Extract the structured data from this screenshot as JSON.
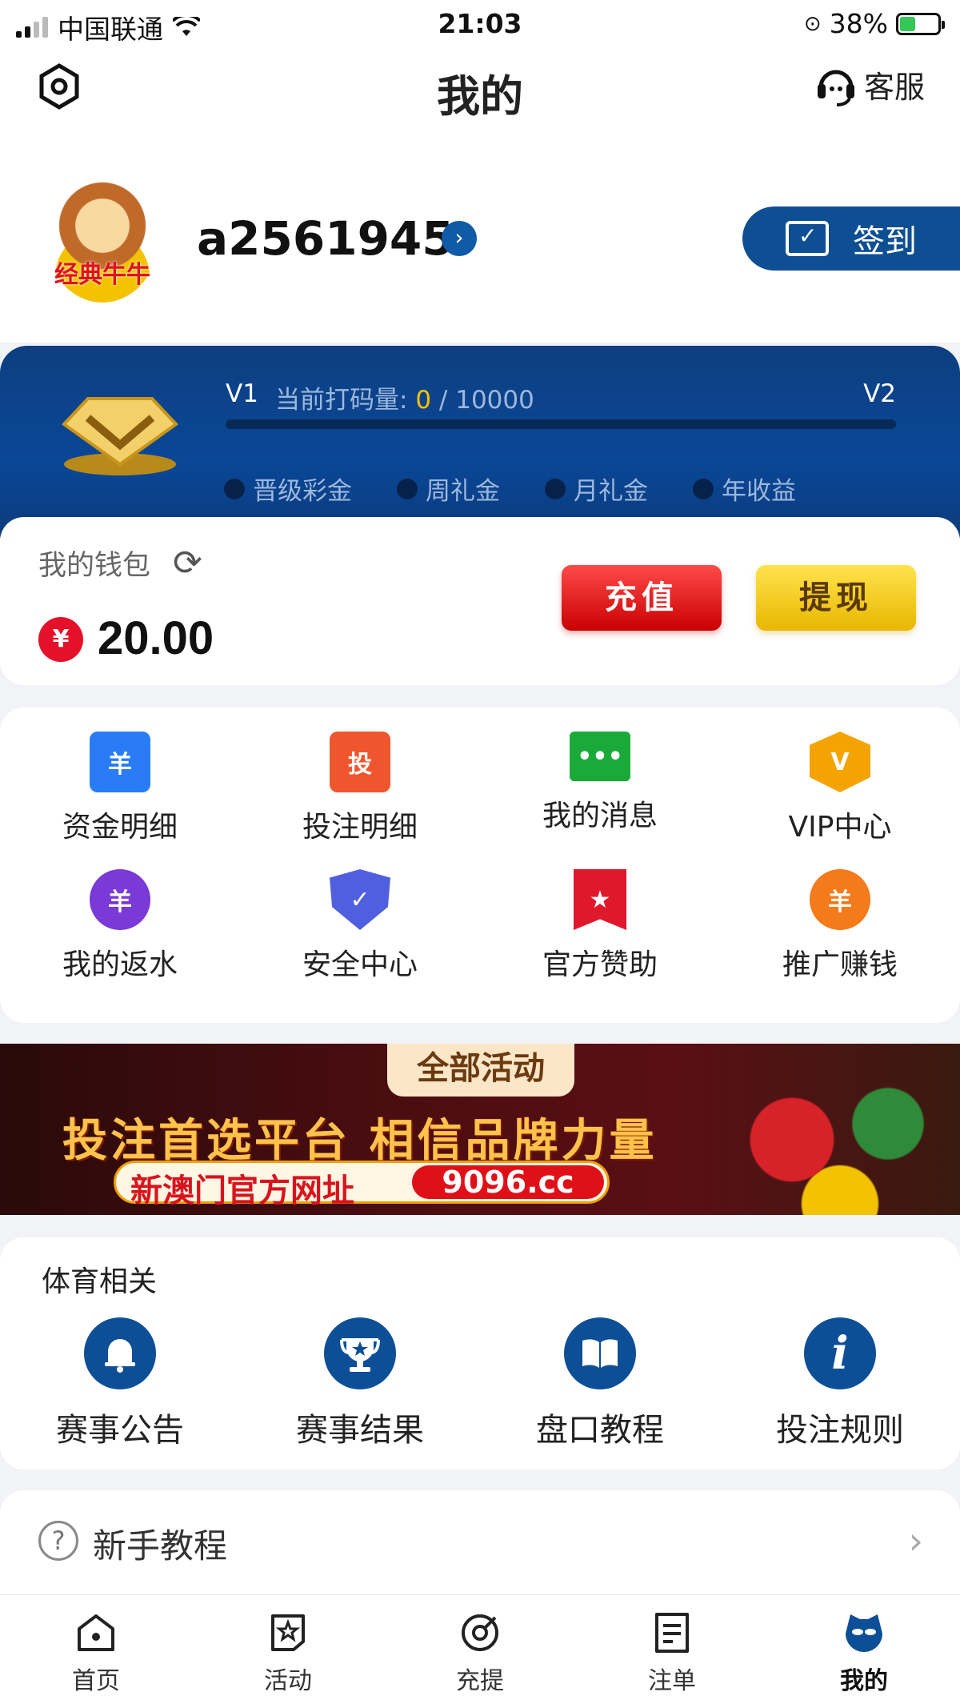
{
  "status_bar": {
    "carrier": "中国联通",
    "time": "21:03",
    "battery_percent": "38%"
  },
  "nav": {
    "title": "我的",
    "settings_icon": "gear-icon",
    "service_label": "客服",
    "service_icon": "headset-icon"
  },
  "profile": {
    "avatar_text": "经典牛牛",
    "username": "a2561945",
    "checkin_label": "签到"
  },
  "vip": {
    "current_level": "V1",
    "progress_label": "当前打码量:",
    "progress_current": "0",
    "progress_sep": "/",
    "progress_target": "10000",
    "progress_fraction": 0,
    "next_level": "V2",
    "perks": [
      "晋级彩金",
      "周礼金",
      "月礼金",
      "年收益"
    ]
  },
  "wallet": {
    "label": "我的钱包",
    "currency_symbol": "¥",
    "balance": "20.00",
    "deposit_label": "充值",
    "withdraw_label": "提现"
  },
  "features": [
    {
      "label": "资金明细",
      "icon": "fund-details-icon",
      "color": "#2a7cf6",
      "glyph": "羊"
    },
    {
      "label": "投注明细",
      "icon": "bet-details-icon",
      "color": "#f0562e",
      "glyph": "投"
    },
    {
      "label": "我的消息",
      "icon": "message-icon",
      "color": "#1aaa39",
      "glyph": "•••"
    },
    {
      "label": "VIP中心",
      "icon": "vip-crown-icon",
      "color": "#f5a300",
      "glyph": "V"
    },
    {
      "label": "我的返水",
      "icon": "rebate-chip-icon",
      "color": "#7a3ad8",
      "glyph": "羊"
    },
    {
      "label": "安全中心",
      "icon": "security-shield-icon",
      "color": "#4f5fe0",
      "glyph": "✓"
    },
    {
      "label": "官方赞助",
      "icon": "sponsor-star-icon",
      "color": "#e0182c",
      "glyph": "★"
    },
    {
      "label": "推广赚钱",
      "icon": "promote-money-icon",
      "color": "#f57a1a",
      "glyph": "羊"
    }
  ],
  "banner": {
    "tag": "全部活动",
    "slogan": "投注首选平台  相信品牌力量",
    "url_label": "新澳门官方网址",
    "url": "9096.cc"
  },
  "sports": {
    "title": "体育相关",
    "items": [
      {
        "label": "赛事公告",
        "icon": "bell-icon"
      },
      {
        "label": "赛事结果",
        "icon": "trophy-icon"
      },
      {
        "label": "盘口教程",
        "icon": "book-icon"
      },
      {
        "label": "投注规则",
        "icon": "info-icon"
      }
    ]
  },
  "tutorial": {
    "label": "新手教程"
  },
  "tabs": [
    {
      "label": "首页",
      "icon": "home-icon",
      "active": false
    },
    {
      "label": "活动",
      "icon": "activity-star-icon",
      "active": false
    },
    {
      "label": "充提",
      "icon": "deposit-withdraw-icon",
      "active": false
    },
    {
      "label": "注单",
      "icon": "bet-slip-icon",
      "active": false
    },
    {
      "label": "我的",
      "icon": "profile-mascot-icon",
      "active": true
    }
  ]
}
